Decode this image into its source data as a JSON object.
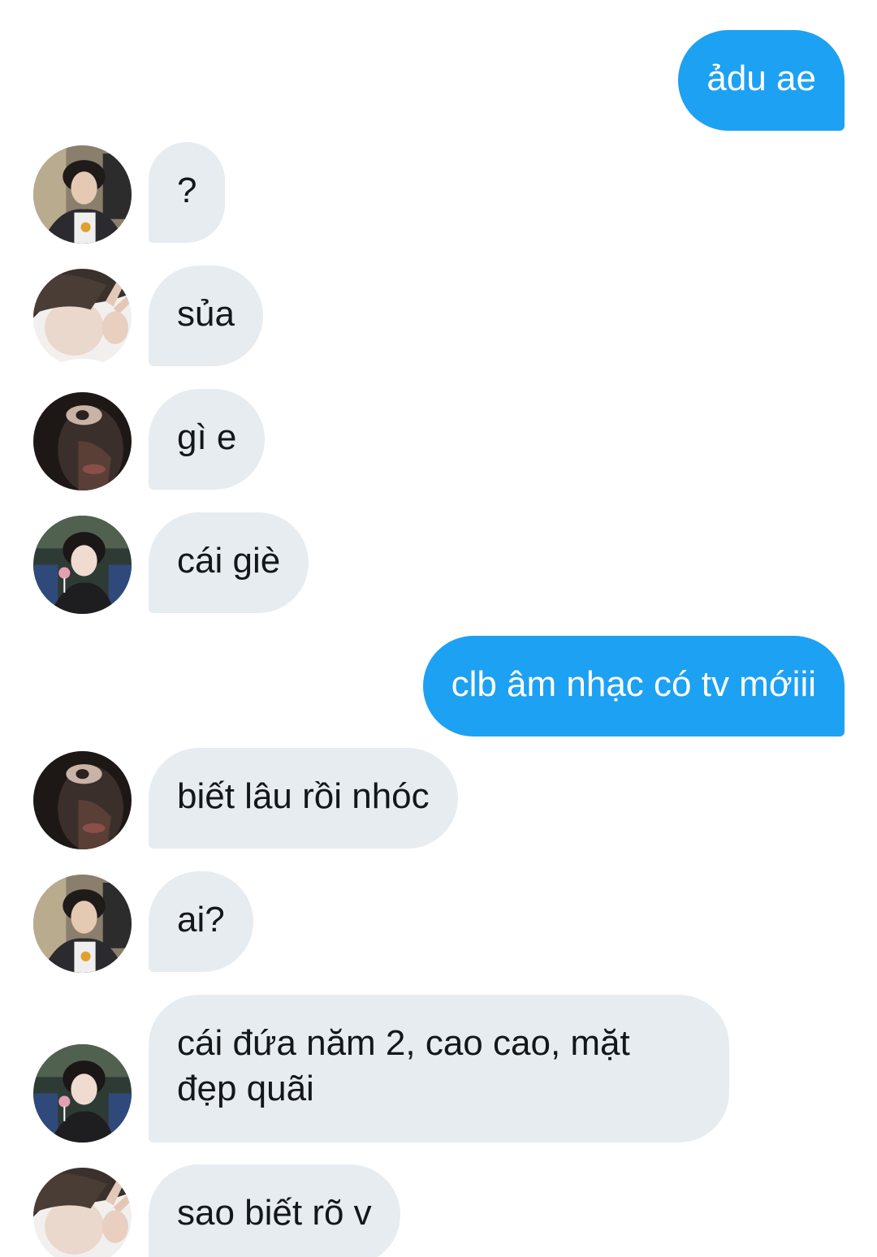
{
  "messages": [
    {
      "side": "sent",
      "text": "ảdu ae"
    },
    {
      "side": "recv",
      "avatar": "avatar-boy-jacket-selfie",
      "text": "?"
    },
    {
      "side": "recv",
      "avatar": "avatar-boy-peace-sign",
      "text": "sủa"
    },
    {
      "side": "recv",
      "avatar": "avatar-boy-hooded-closeup",
      "text": "gì e"
    },
    {
      "side": "recv",
      "avatar": "avatar-boy-train-lollipop",
      "text": "cái giè"
    },
    {
      "side": "sent",
      "text": "clb âm nhạc có tv mớiii"
    },
    {
      "side": "recv",
      "avatar": "avatar-boy-hooded-closeup",
      "text": "biết lâu rồi nhóc"
    },
    {
      "side": "recv",
      "avatar": "avatar-boy-jacket-selfie",
      "text": "ai?"
    },
    {
      "side": "recv",
      "avatar": "avatar-boy-train-lollipop",
      "text": "cái đứa năm 2, cao cao, mặt\nđẹp quãi"
    },
    {
      "side": "recv",
      "avatar": "avatar-boy-peace-sign",
      "text": "sao biết rõ v"
    }
  ],
  "colors": {
    "sent_bubble": "#1da1f2",
    "received_bubble": "#e6ecf0",
    "background": "#ffffff"
  }
}
